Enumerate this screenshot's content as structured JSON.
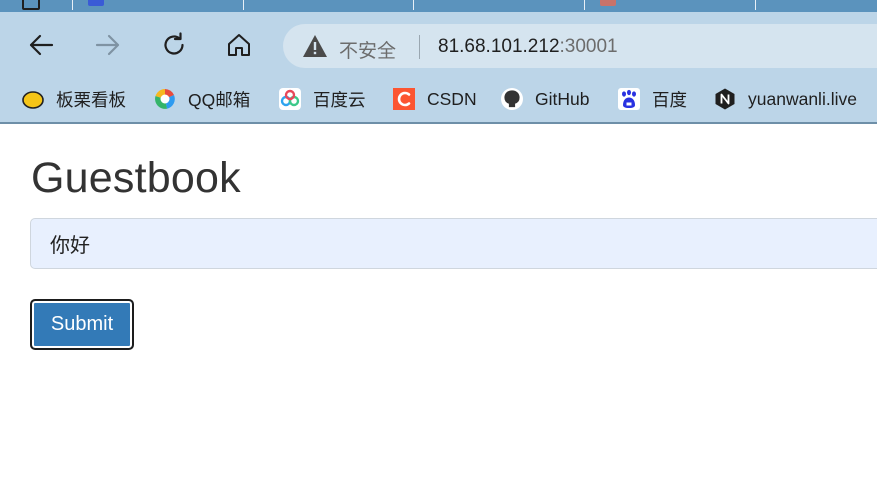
{
  "browser": {
    "address_bar": {
      "security_label": "不安全",
      "url_host": "81.68.101.212",
      "url_port": ":30001"
    },
    "bookmarks": [
      {
        "label": "板栗看板",
        "icon": "chestnut-icon"
      },
      {
        "label": "QQ邮箱",
        "icon": "qq-mail-icon"
      },
      {
        "label": "百度云",
        "icon": "baidu-cloud-icon"
      },
      {
        "label": "CSDN",
        "icon": "csdn-icon"
      },
      {
        "label": "GitHub",
        "icon": "github-icon"
      },
      {
        "label": "百度",
        "icon": "baidu-icon"
      },
      {
        "label": "yuanwanli.live",
        "icon": "n-logo-icon"
      }
    ],
    "nav_icons": [
      "back-arrow-icon",
      "forward-arrow-icon",
      "reload-icon",
      "home-icon"
    ],
    "colors": {
      "tab_strip": "#5b93bd",
      "toolbar": "#bcd5e8",
      "address_bar": "#d5e4ef"
    }
  },
  "page": {
    "title": "Guestbook",
    "message_input": {
      "value": "你好"
    },
    "submit_label": "Submit",
    "colors": {
      "button": "#337ab7",
      "input_background": "#e8f0fe",
      "title": "#333333"
    }
  }
}
